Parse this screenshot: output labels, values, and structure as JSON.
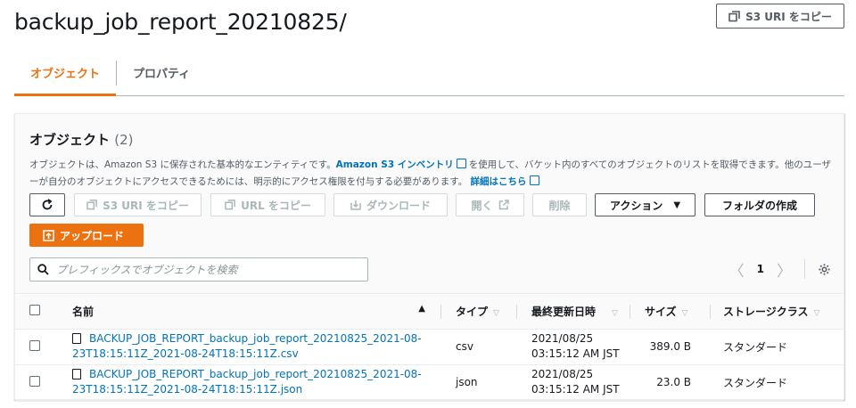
{
  "page": {
    "title": "backup_job_report_20210825/",
    "copy_s3_uri_label": "S3 URI をコピー"
  },
  "tabs": [
    {
      "label": "オブジェクト",
      "active": true
    },
    {
      "label": "プロパティ",
      "active": false
    }
  ],
  "objects": {
    "title": "オブジェクト",
    "count": "(2)",
    "desc_part1": "オブジェクトは、Amazon S3 に保存された基本的なエンティティです。",
    "inventory_link": "Amazon S3 インベントリ",
    "desc_part2": "を使用して、バケット内のすべてのオブジェクトのリストを取得できます。他のユーザーが自分のオブジェクトにアクセスできるためには、明示的にアクセス権限を付与する必要があります。",
    "details_link": "詳細はこちら"
  },
  "toolbar": {
    "copy_s3_uri": "S3 URI をコピー",
    "copy_url": "URL をコピー",
    "download": "ダウンロード",
    "open": "開く",
    "delete": "削除",
    "actions": "アクション",
    "create_folder": "フォルダの作成",
    "upload": "アップロード"
  },
  "search": {
    "placeholder": "プレフィックスでオブジェクトを検索"
  },
  "pagination": {
    "page": "1"
  },
  "table": {
    "columns": [
      "名前",
      "タイプ",
      "最終更新日時",
      "サイズ",
      "ストレージクラス"
    ],
    "rows": [
      {
        "name_line1": "BACKUP_JOB_REPORT_backup_job_report_20210825_2021-08-",
        "name_line2": "23T18:15:11Z_2021-08-24T18:15:11Z.csv",
        "type": "csv",
        "date": "2021/08/25",
        "time": "03:15:12 AM JST",
        "size": "389.0 B",
        "storage": "スタンダード"
      },
      {
        "name_line1": "BACKUP_JOB_REPORT_backup_job_report_20210825_2021-08-",
        "name_line2": "23T18:15:11Z_2021-08-24T18:15:11Z.json",
        "type": "json",
        "date": "2021/08/25",
        "time": "03:15:12 AM JST",
        "size": "23.0 B",
        "storage": "スタンダード"
      }
    ]
  },
  "colors": {
    "accent": "#ec7211",
    "link": "#0073bb"
  }
}
